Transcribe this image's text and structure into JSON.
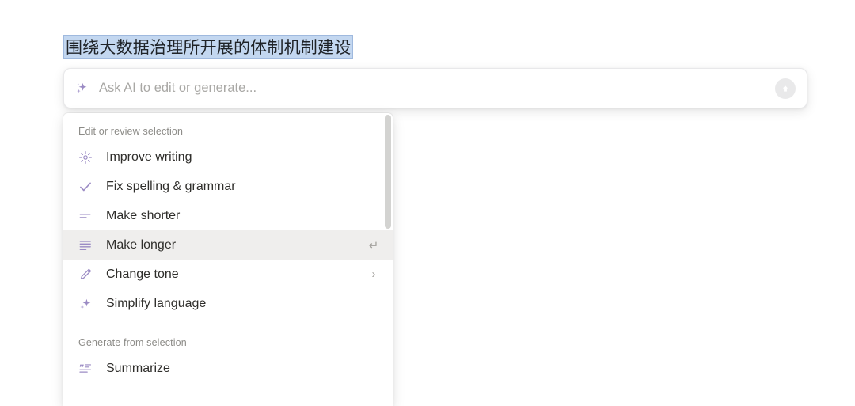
{
  "document": {
    "selected_text": "围绕大数据治理所开展的体制机制建设"
  },
  "ai_bar": {
    "icon": "sparkle-icon",
    "input_value": "",
    "placeholder": "Ask AI to edit or generate...",
    "submit_icon": "arrow-up-circle-icon"
  },
  "menu": {
    "sections": [
      {
        "label": "Edit or review selection",
        "items": [
          {
            "label": "Improve writing",
            "icon": "sparkle-burst-icon",
            "right": "",
            "active": false
          },
          {
            "label": "Fix spelling & grammar",
            "icon": "check-icon",
            "right": "",
            "active": false
          },
          {
            "label": "Make shorter",
            "icon": "shorten-lines-icon",
            "right": "",
            "active": false
          },
          {
            "label": "Make longer",
            "icon": "lengthen-lines-icon",
            "right": "↵",
            "active": true
          },
          {
            "label": "Change tone",
            "icon": "pen-icon",
            "right": "›",
            "active": false
          },
          {
            "label": "Simplify language",
            "icon": "sparkle-icon",
            "right": "",
            "active": false
          }
        ]
      },
      {
        "label": "Generate from selection",
        "items": [
          {
            "label": "Summarize",
            "icon": "quote-lines-icon",
            "right": "",
            "active": false
          }
        ]
      }
    ],
    "scrollbar": {
      "visible": true
    }
  },
  "colors": {
    "accent_purple": "#9b8bc4",
    "selection_blue": "#c3d7f0",
    "hover_gray": "#efeeed",
    "text_primary": "#2f2e2b",
    "text_muted": "#8c8b87"
  }
}
